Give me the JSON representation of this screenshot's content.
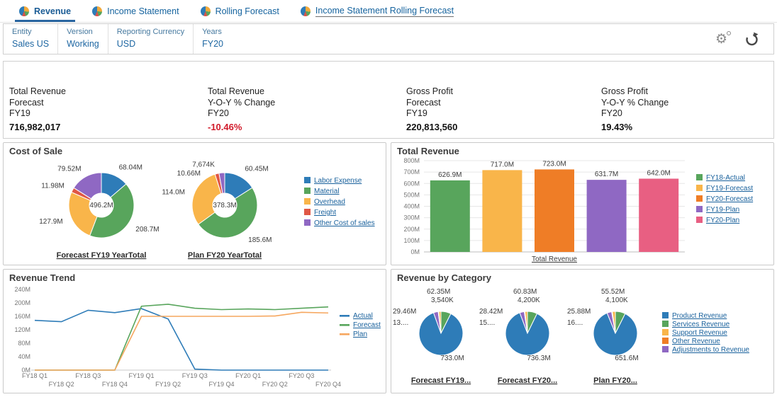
{
  "app": {
    "tabs": [
      {
        "label": "Revenue",
        "active": true,
        "underlined": false
      },
      {
        "label": "Income Statement",
        "active": false,
        "underlined": false
      },
      {
        "label": "Rolling Forecast",
        "active": false,
        "underlined": false
      },
      {
        "label": "Income Statement Rolling Forecast",
        "active": false,
        "underlined": true
      }
    ],
    "pov": {
      "fields": [
        {
          "label": "Entity",
          "value": "Sales US"
        },
        {
          "label": "Version",
          "value": "Working"
        },
        {
          "label": "Reporting Currency",
          "value": "USD"
        },
        {
          "label": "Years",
          "value": "FY20"
        }
      ],
      "icons": [
        "settings-gear-icon",
        "refresh-icon"
      ]
    }
  },
  "kpis": [
    {
      "lines": [
        "Total Revenue",
        "Forecast",
        "FY19"
      ],
      "value": "716,982,017",
      "negative": false
    },
    {
      "lines": [
        "Total Revenue",
        "Y-O-Y % Change",
        "FY20"
      ],
      "value": "-10.46%",
      "negative": true
    },
    {
      "lines": [
        "Gross Profit",
        "Forecast",
        "FY19"
      ],
      "value": "220,813,560",
      "negative": false
    },
    {
      "lines": [
        "Gross Profit",
        "Y-O-Y % Change",
        "FY20"
      ],
      "value": "19.43%",
      "negative": false
    }
  ],
  "colors": {
    "blue": "#2e7cb8",
    "green": "#58a55c",
    "amber": "#f9b54a",
    "orange": "#ef7d26",
    "red": "#e05745",
    "purple": "#8f68c3",
    "pink": "#e85f82",
    "lightorange": "#f6a75f"
  },
  "chart_data": [
    {
      "id": "cost_of_sale",
      "type": "donut-multi",
      "title": "Cost of Sale",
      "legend": [
        "Labor Expense",
        "Material",
        "Overhead",
        "Freight",
        "Other Cost of sales"
      ],
      "legend_colors": [
        "blue",
        "green",
        "amber",
        "red",
        "purple"
      ],
      "donuts": [
        {
          "title": "Forecast FY19 YearTotal",
          "total_label": "496.2M",
          "slices": [
            {
              "name": "Labor Expense",
              "value": 68.04,
              "label": "68.04M",
              "color": "blue"
            },
            {
              "name": "Material",
              "value": 208.7,
              "label": "208.7M",
              "color": "green"
            },
            {
              "name": "Overhead",
              "value": 127.9,
              "label": "127.9M",
              "color": "amber"
            },
            {
              "name": "Freight",
              "value": 11.98,
              "label": "11.98M",
              "color": "red"
            },
            {
              "name": "Other Cost of sales",
              "value": 79.52,
              "label": "79.52M",
              "color": "purple"
            }
          ]
        },
        {
          "title": "Plan FY20 YearTotal",
          "total_label": "378.3M",
          "slices": [
            {
              "name": "Labor Expense",
              "value": 60.45,
              "label": "60.45M",
              "color": "blue"
            },
            {
              "name": "Material",
              "value": 185.6,
              "label": "185.6M",
              "color": "green"
            },
            {
              "name": "Overhead",
              "value": 114.0,
              "label": "114.0M",
              "color": "amber"
            },
            {
              "name": "Freight",
              "value": 7.674,
              "label": "7,674K",
              "color": "red"
            },
            {
              "name": "Other Cost of sales",
              "value": 10.66,
              "label": "10.66M",
              "color": "purple"
            }
          ]
        }
      ]
    },
    {
      "id": "total_revenue",
      "type": "bar",
      "title": "Total Revenue",
      "categories": [
        "FY18-Actual",
        "FY19-Forecast",
        "FY20-Forecast",
        "FY19-Plan",
        "FY20-Plan"
      ],
      "values": [
        626.9,
        717.0,
        723.0,
        631.7,
        642.0
      ],
      "value_labels": [
        "626.9M",
        "717.0M",
        "723.0M",
        "631.7M",
        "642.0M"
      ],
      "bar_colors": [
        "green",
        "amber",
        "orange",
        "purple",
        "pink"
      ],
      "xlabel": "Total Revenue",
      "ylim": [
        0,
        800
      ],
      "ytick_step": 100,
      "ytick_suffix": "M",
      "legend": [
        "FY18-Actual",
        "FY19-Forecast",
        "FY20-Forecast",
        "FY19-Plan",
        "FY20-Plan"
      ],
      "legend_position": "right",
      "grid": true
    },
    {
      "id": "revenue_trend",
      "type": "line",
      "title": "Revenue Trend",
      "x_labels": [
        "FY18 Q1",
        "FY18 Q2",
        "FY18 Q3",
        "FY18 Q4",
        "FY19 Q1",
        "FY19 Q2",
        "FY19 Q3",
        "FY19 Q4",
        "FY20 Q1",
        "FY20 Q2",
        "FY20 Q3",
        "FY20 Q4"
      ],
      "ylim": [
        0,
        240
      ],
      "ytick_step": 40,
      "ytick_suffix": "M",
      "legend_position": "right",
      "grid": false,
      "series": [
        {
          "name": "Actual",
          "color": "blue",
          "values": [
            148,
            144,
            178,
            171,
            183,
            152,
            3,
            0,
            0,
            0,
            0,
            0
          ]
        },
        {
          "name": "Forecast",
          "color": "green",
          "values": [
            0,
            0,
            0,
            0,
            190,
            196,
            184,
            180,
            182,
            180,
            184,
            188
          ]
        },
        {
          "name": "Plan",
          "color": "lightorange",
          "values": [
            0,
            0,
            0,
            0,
            160,
            160,
            160,
            160,
            160,
            161,
            172,
            170
          ]
        }
      ]
    },
    {
      "id": "revenue_by_category",
      "type": "pie-multi",
      "title": "Revenue by Category",
      "legend": [
        "Product Revenue",
        "Services Revenue",
        "Support Revenue",
        "Other Revenue",
        "Adjustments to Revenue"
      ],
      "legend_colors": [
        "blue",
        "green",
        "amber",
        "orange",
        "purple"
      ],
      "pies": [
        {
          "title": "Forecast FY19...",
          "slices": [
            {
              "name": "Services Revenue",
              "value": 62.35,
              "label": "62.35M",
              "color": "green"
            },
            {
              "name": "Product Revenue",
              "value": 733.0,
              "label": "733.0M",
              "color": "blue"
            },
            {
              "name": "Adjustments to Revenue",
              "value": 29.46,
              "label": "29.46M",
              "color": "purple"
            },
            {
              "name": "Other Revenue",
              "value": 3.54,
              "label": "3,540K",
              "color": "orange"
            },
            {
              "name": "Support Revenue",
              "value": 13.5,
              "label": "13....",
              "color": "amber"
            }
          ]
        },
        {
          "title": "Forecast FY20...",
          "slices": [
            {
              "name": "Services Revenue",
              "value": 60.83,
              "label": "60.83M",
              "color": "green"
            },
            {
              "name": "Product Revenue",
              "value": 736.3,
              "label": "736.3M",
              "color": "blue"
            },
            {
              "name": "Adjustments to Revenue",
              "value": 28.42,
              "label": "28.42M",
              "color": "purple"
            },
            {
              "name": "Other Revenue",
              "value": 4.2,
              "label": "4,200K",
              "color": "orange"
            },
            {
              "name": "Support Revenue",
              "value": 15.5,
              "label": "15....",
              "color": "amber"
            }
          ]
        },
        {
          "title": "Plan FY20...",
          "slices": [
            {
              "name": "Services Revenue",
              "value": 55.52,
              "label": "55.52M",
              "color": "green"
            },
            {
              "name": "Product Revenue",
              "value": 651.6,
              "label": "651.6M",
              "color": "blue"
            },
            {
              "name": "Adjustments to Revenue",
              "value": 25.88,
              "label": "25.88M",
              "color": "purple"
            },
            {
              "name": "Other Revenue",
              "value": 4.1,
              "label": "4,100K",
              "color": "orange"
            },
            {
              "name": "Support Revenue",
              "value": 16.5,
              "label": "16....",
              "color": "amber"
            }
          ]
        }
      ]
    }
  ]
}
